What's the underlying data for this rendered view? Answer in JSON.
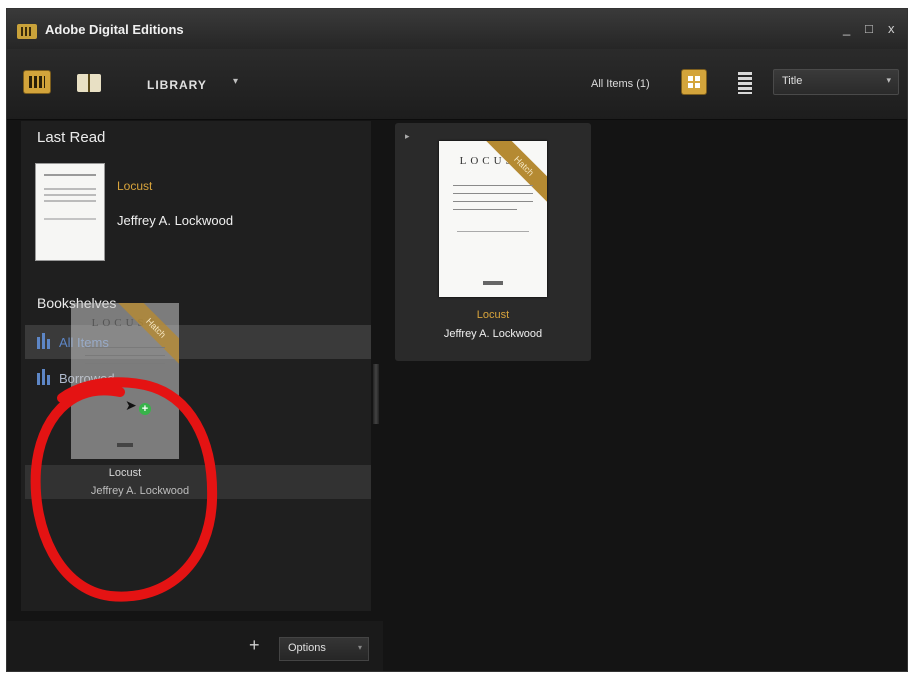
{
  "window": {
    "title": "Adobe Digital Editions",
    "controls": [
      "_",
      "□",
      "x"
    ]
  },
  "toolbar": {
    "library_label": "LIBRARY",
    "all_items_label": "All Items (1)",
    "sort_value": "Title"
  },
  "last_read": {
    "heading": "Last Read",
    "book_title": "Locust",
    "book_author": "Jeffrey A. Lockwood"
  },
  "bookshelves": {
    "heading": "Bookshelves",
    "items": [
      {
        "label": "All Items",
        "active": true
      },
      {
        "label": "Borrowed",
        "active": false
      }
    ]
  },
  "bottom": {
    "add_label": "+",
    "options_label": "Options"
  },
  "library_books": [
    {
      "cover_title": "LOCUST",
      "badge": "Hatch",
      "title": "Locust",
      "author": "Jeffrey A. Lockwood"
    }
  ],
  "drag_ghost": {
    "cover_title": "LOCUST",
    "badge": "Hatch",
    "title": "Locust",
    "author": "Jeffrey A. Lockwood"
  },
  "colors": {
    "accent": "#d3a43b",
    "shelf_blue": "#5d86c6",
    "annotation_red": "#e41313"
  }
}
